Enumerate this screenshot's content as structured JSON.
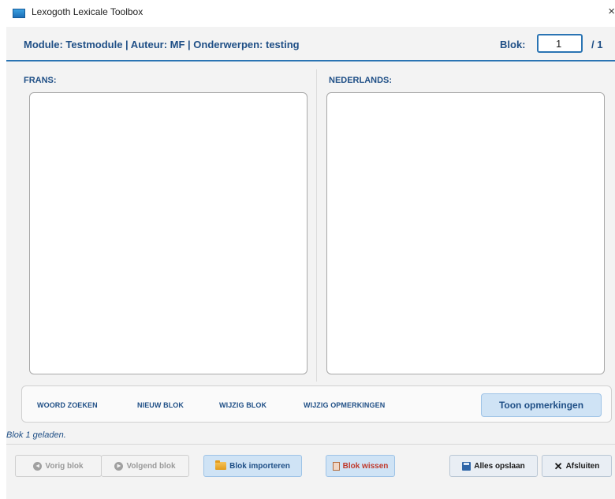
{
  "window": {
    "title": "Lexogoth Lexicale Toolbox",
    "close_label": "×"
  },
  "header": {
    "module_info": "Module: Testmodule | Auteur: MF | Onderwerpen: testing",
    "blok_label": "Blok:",
    "blok_value": "1",
    "blok_total": "/ 1"
  },
  "panels": {
    "left_label": "FRANS:",
    "right_label": "NEDERLANDS:",
    "left_text": "",
    "right_text": ""
  },
  "toolbar": {
    "woord_zoeken": "WOORD ZOEKEN",
    "nieuw_blok": "NIEUW BLOK",
    "wijzig_blok": "WIJZIG BLOK",
    "wijzig_opmerkingen": "WIJZIG OPMERKINGEN",
    "toon_opmerkingen": "Toon opmerkingen"
  },
  "status": {
    "message": "Blok 1 geladen."
  },
  "buttons": {
    "vorig_blok": "Vorig blok",
    "volgend_blok": "Volgend blok",
    "blok_importeren": "Blok importeren",
    "blok_wissen": "Blok wissen",
    "alles_opslaan": "Alles opslaan",
    "afsluiten": "Afsluiten"
  },
  "icons": {
    "app": "app-icon",
    "prev": "arrow-left-circle-icon",
    "next": "arrow-right-circle-icon",
    "import": "folder-icon",
    "delete": "trash-icon",
    "save": "floppy-disk-icon",
    "exit": "x-icon"
  },
  "colors": {
    "accent": "#2a74b3",
    "label_text": "#1f4f86",
    "button_blue": "#cfe3f5",
    "danger_text": "#c0392b"
  }
}
